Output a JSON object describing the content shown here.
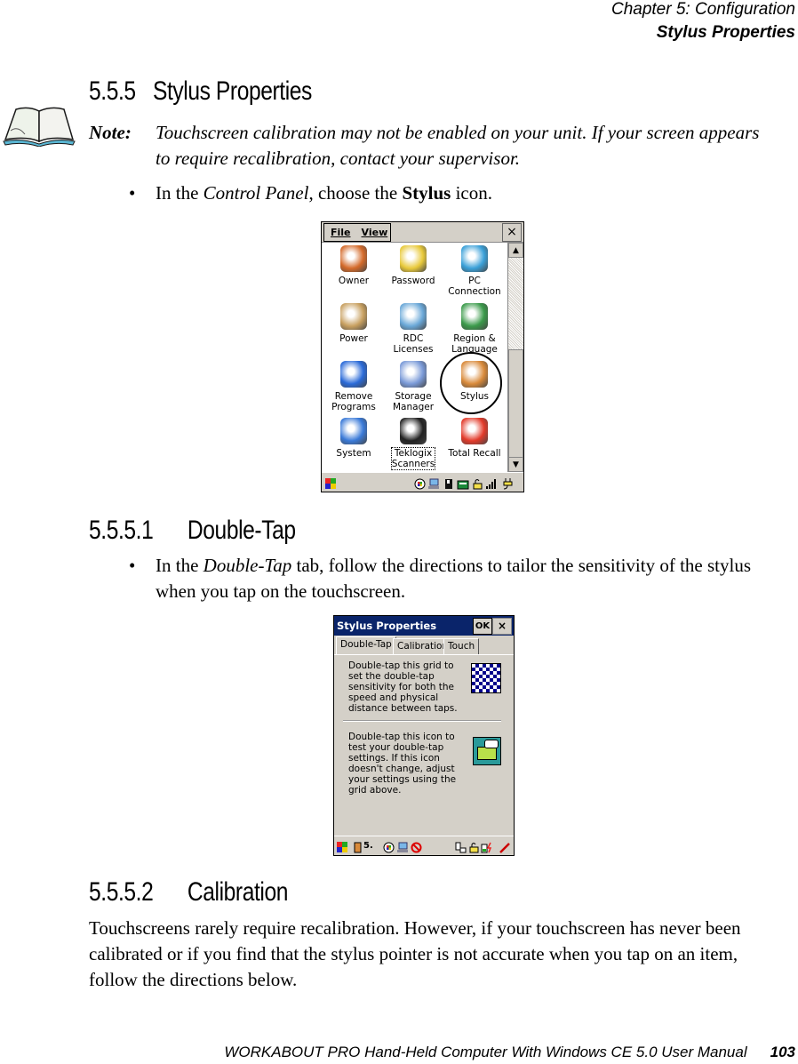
{
  "header": {
    "chapter": "Chapter  5:  Configuration",
    "section": "Stylus Properties"
  },
  "section_555": {
    "number": "5.5.5",
    "title": "Stylus Properties",
    "note_label": "Note:",
    "note_text": "Touchscreen calibration may not be enabled on your unit. If your screen appears to require recalibration, contact your supervisor.",
    "bullet": "•",
    "instruction_pre": "In the ",
    "instruction_italic": "Control Panel",
    "instruction_mid": ", choose the ",
    "instruction_bold": "Stylus",
    "instruction_post": " icon."
  },
  "control_panel": {
    "menu": [
      "File",
      "View"
    ],
    "close": "×",
    "items": [
      {
        "label": "Owner",
        "icon": "owner-icon"
      },
      {
        "label": "Password",
        "icon": "password-icon"
      },
      {
        "label": "PC\nConnection",
        "icon": "pc-connection-icon"
      },
      {
        "label": "Power",
        "icon": "power-icon"
      },
      {
        "label": "RDC\nLicenses",
        "icon": "rdc-licenses-icon"
      },
      {
        "label": "Region &\nLanguage",
        "icon": "region-language-icon"
      },
      {
        "label": "Remove\nPrograms",
        "icon": "remove-programs-icon"
      },
      {
        "label": "Storage\nManager",
        "icon": "storage-manager-icon"
      },
      {
        "label": "Stylus",
        "icon": "stylus-icon"
      },
      {
        "label": "System",
        "icon": "system-icon"
      },
      {
        "label": "Teklogix\nScanners",
        "icon": "teklogix-scanners-icon"
      },
      {
        "label": "Total Recall",
        "icon": "total-recall-icon"
      }
    ],
    "tray_icons": [
      "start-icon",
      "color-wheel-icon",
      "network-icon",
      "card-icon",
      "phone-icon",
      "lock-icon",
      "signal-icon",
      "power-plug-icon"
    ]
  },
  "section_5551": {
    "number": "5.5.5.1",
    "title": "Double-Tap",
    "bullet": "•",
    "text_pre": "In the ",
    "text_italic": "Double-Tap",
    "text_post": " tab, follow the directions to tailor the sensitivity of the stylus when you tap on the touchscreen."
  },
  "stylus_dialog": {
    "title": "Stylus Properties",
    "ok": "OK",
    "close": "×",
    "tabs": [
      "Double-Tap",
      "Calibration",
      "Touch"
    ],
    "active_tab": "Double-Tap",
    "grid_text": "Double-tap this grid to set the double-tap sensitivity for both the speed and physical distance between taps.",
    "icon_text": "Double-tap this icon to test your double-tap settings. If this icon doesn't change, adjust your settings using the grid above.",
    "taskbar_label": "5."
  },
  "section_5552": {
    "number": "5.5.5.2",
    "title": "Calibration",
    "text": "Touchscreens rarely require recalibration. However, if your touchscreen has never been calibrated or if you find that the stylus pointer is not accurate when you tap on an item, follow the directions below."
  },
  "footer": {
    "manual": "WORKABOUT PRO Hand-Held Computer With Windows CE 5.0 User Manual",
    "page": "103"
  }
}
